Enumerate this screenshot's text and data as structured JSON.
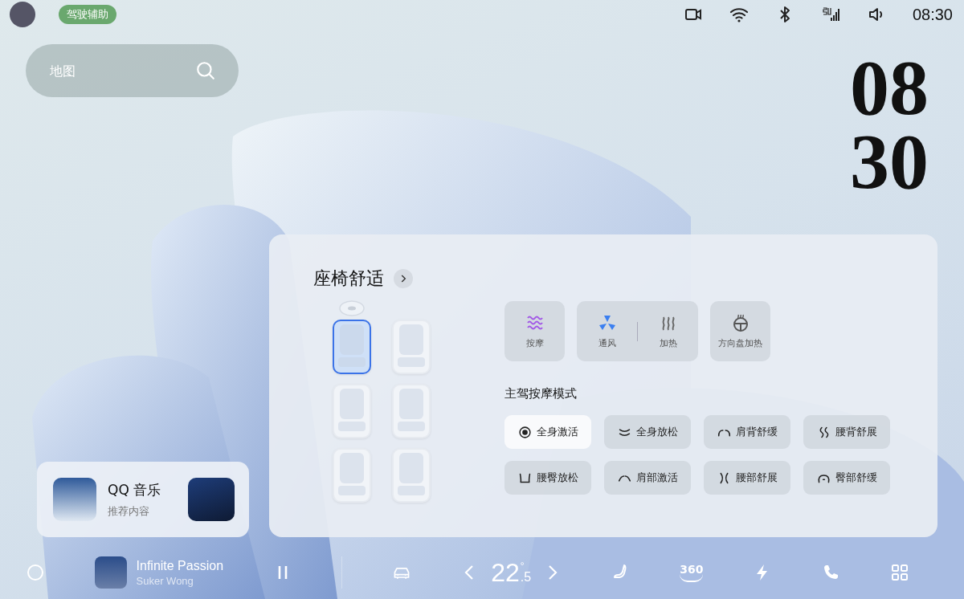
{
  "status_bar": {
    "assist_chip": "驾驶辅助",
    "time": "08:30"
  },
  "search": {
    "placeholder": "地图"
  },
  "clock": {
    "hours": "08",
    "minutes": "30"
  },
  "music_card": {
    "title": "QQ 音乐",
    "subtitle": "推荐内容"
  },
  "seat_panel": {
    "title": "座椅舒适",
    "seats": [
      {
        "selected": true
      },
      {
        "selected": false
      },
      {
        "selected": false
      },
      {
        "selected": false
      },
      {
        "selected": false
      },
      {
        "selected": false
      }
    ],
    "function_tiles": [
      {
        "items": [
          {
            "kind": "massage",
            "label": "按摩",
            "on": true
          }
        ]
      },
      {
        "items": [
          {
            "kind": "fan",
            "label": "通风",
            "on": true
          },
          {
            "kind": "heat",
            "label": "加热",
            "on": false
          }
        ]
      },
      {
        "items": [
          {
            "kind": "wheel",
            "label": "方向盘加热",
            "on": false
          }
        ]
      }
    ],
    "mode_title": "主驾按摩模式",
    "modes": [
      {
        "kind": "target",
        "label": "全身激活",
        "selected": true
      },
      {
        "kind": "relax",
        "label": "全身放松",
        "selected": false
      },
      {
        "kind": "shoulder-back",
        "label": "肩背舒缓",
        "selected": false
      },
      {
        "kind": "waist-back",
        "label": "腰背舒展",
        "selected": false
      },
      {
        "kind": "hip",
        "label": "腰臀放松",
        "selected": false
      },
      {
        "kind": "shoulder",
        "label": "肩部激活",
        "selected": false
      },
      {
        "kind": "waist",
        "label": "腰部舒展",
        "selected": false
      },
      {
        "kind": "buttock",
        "label": "臀部舒缓",
        "selected": false
      }
    ]
  },
  "dock": {
    "track": "Infinite Passion",
    "artist": "Suker Wong",
    "temperature": "22",
    "temperature_unit": "°",
    "temperature_decimal": ".5",
    "view_label": "360"
  }
}
